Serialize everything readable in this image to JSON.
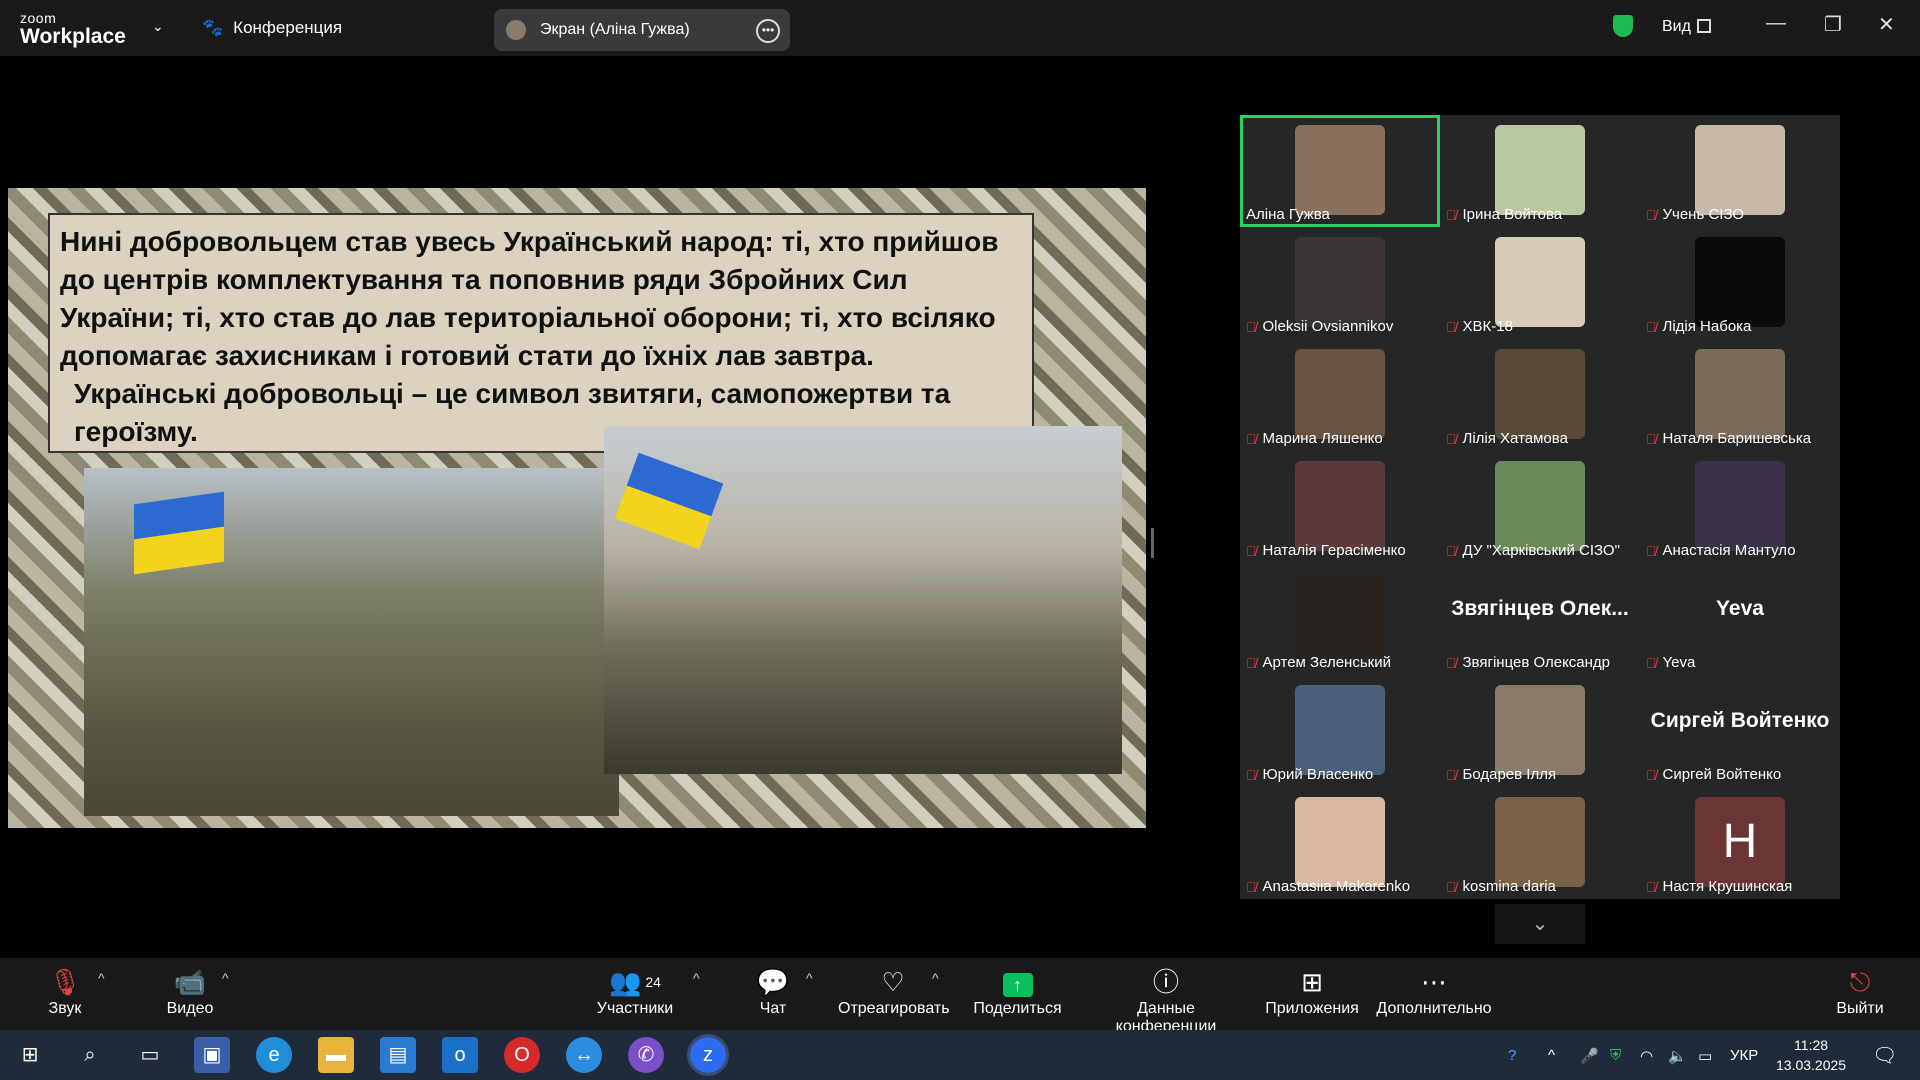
{
  "titlebar": {
    "brand_small": "zoom",
    "brand_large": "Workplace",
    "meeting_label": "Конференция",
    "share_pill_label": "Экран (Аліна Гужва)",
    "view_label": "Вид"
  },
  "slide": {
    "paragraph1": "Нині добровольцем став увесь Український народ: ті, хто прийшов до центрів комплектування та поповнив ряди Збройних Сил України; ті, хто став до лав територіальної оборони; ті, хто всіляко допомагає захисникам і готовий стати до їхніх лав завтра.",
    "paragraph2": "Українські добровольці – це символ звитяги, самопожертви та героїзму."
  },
  "participants": [
    {
      "name": "Аліна Гужва",
      "muted": false,
      "active": true,
      "face_color": "#8a6f5c"
    },
    {
      "name": "Ірина Войтова",
      "muted": true,
      "face_color": "#b8c8a0"
    },
    {
      "name": "Учень СІЗО",
      "muted": true,
      "face_color": "#c8b8a8"
    },
    {
      "name": "Oleksii Ovsiannikov",
      "muted": true,
      "face_color": "#3a3338"
    },
    {
      "name": "ХВК-18",
      "muted": true,
      "face_color": "#d8cbb8"
    },
    {
      "name": "Лідія Набока",
      "muted": true,
      "face_color": "#0a0a0a"
    },
    {
      "name": "Марина Ляшенко",
      "muted": true,
      "face_color": "#6a5240"
    },
    {
      "name": "Лілія Хатамова",
      "muted": true,
      "face_color": "#5a4a3a"
    },
    {
      "name": "Наталя Баришевська",
      "muted": true,
      "face_color": "#7a6a5a"
    },
    {
      "name": "Наталія Герасіменко",
      "muted": true,
      "face_color": "#5a3a3a"
    },
    {
      "name": "ДУ \"Харківський СІЗО\"",
      "muted": true,
      "face_color": "#6a8a5a"
    },
    {
      "name": "Анастасія Мантуло",
      "muted": true,
      "face_color": "#3a3048"
    },
    {
      "name": "Артем Зеленський",
      "muted": true,
      "face_color": "#2a2420"
    },
    {
      "name": "Звягінцев Олександр",
      "muted": true,
      "display_name": "Звягінцев Олек..."
    },
    {
      "name": "Yeva",
      "muted": true,
      "display_name": "Yeva"
    },
    {
      "name": "Юрий Власенко",
      "muted": true,
      "face_color": "#4a6078"
    },
    {
      "name": "Бодарев Ілля",
      "muted": true,
      "face_color": "#8a7a6a"
    },
    {
      "name": "Сиргей Войтенко",
      "muted": true,
      "display_name": "Сиргей Войтенко"
    },
    {
      "name": "Anastasiia Makarenko",
      "muted": true,
      "face_color": "#d8b8a0"
    },
    {
      "name": "kosmina daria",
      "muted": true,
      "face_color": "#7a6048"
    },
    {
      "name": "Настя Крушинская",
      "muted": true,
      "initial": "Н"
    }
  ],
  "toolbar": {
    "audio": "Звук",
    "video": "Видео",
    "participants": "Участники",
    "participants_count": "24",
    "chat": "Чат",
    "react": "Отреагировать",
    "share": "Поделиться",
    "info": "Данные конференции",
    "apps": "Приложения",
    "more": "Дополнительно",
    "leave": "Выйти"
  },
  "taskbar": {
    "lang": "УКР",
    "time": "11:28",
    "date": "13.03.2025"
  },
  "colors": {
    "active_speaker": "#24d364",
    "share_green": "#0bbf5e",
    "muted_red": "#e0433a"
  }
}
